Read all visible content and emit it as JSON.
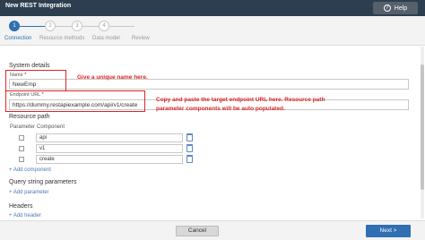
{
  "window": {
    "title": "New REST Integration",
    "help_label": "Help"
  },
  "wizard": {
    "steps": [
      {
        "number": "1",
        "label": "Connection"
      },
      {
        "number": "2",
        "label": "Resource methods"
      },
      {
        "number": "3",
        "label": "Data model"
      },
      {
        "number": "4",
        "label": "Review"
      }
    ]
  },
  "system_details": {
    "heading": "System details",
    "name_label": "Name",
    "name_value": "NewEmp",
    "endpoint_label": "Endpoint URL",
    "endpoint_value": "https://dummy.restapiexample.com/api/v1/create",
    "required_mark": "*"
  },
  "annotations": {
    "name_note": "Give a unique name here.",
    "endpoint_note_line1": "Copy and paste the target endpoint URL here. Resource path",
    "endpoint_note_line2": "parameter components will be auto populated."
  },
  "resource_path": {
    "heading": "Resource path",
    "col_parameter": "Parameter",
    "col_component": "Component",
    "rows": [
      "api",
      "v1",
      "create"
    ],
    "add_label": "+ Add component"
  },
  "query_string": {
    "heading": "Query string parameters",
    "add_label": "+ Add parameter"
  },
  "headers": {
    "heading": "Headers",
    "add_label": "+ Add header"
  },
  "footer": {
    "cancel_label": "Cancel",
    "next_label": "Next >"
  }
}
